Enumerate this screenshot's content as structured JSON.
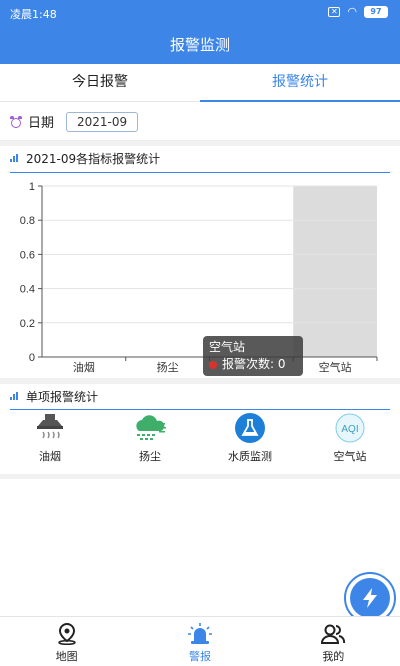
{
  "status_bar": {
    "time": "凌晨1:48",
    "battery": "97"
  },
  "header": {
    "title": "报警监测"
  },
  "tabs": [
    {
      "label": "今日报警",
      "active": false
    },
    {
      "label": "报警统计",
      "active": true
    }
  ],
  "date_filter": {
    "label": "日期",
    "value": "2021-09"
  },
  "chart_section": {
    "title": "2021-09各指标报警统计"
  },
  "chart_data": {
    "type": "bar",
    "categories": [
      "油烟",
      "扬尘",
      "水质监测",
      "空气站"
    ],
    "visible_category_labels": [
      "油烟",
      "扬尘",
      "",
      "空气站"
    ],
    "series": [
      {
        "name": "报警次数",
        "values": [
          0,
          0,
          0,
          0
        ]
      }
    ],
    "ylim": [
      0,
      1
    ],
    "yticks": [
      "0",
      "0.2",
      "0.4",
      "0.6",
      "0.8",
      "1"
    ],
    "highlighted_category": "空气站",
    "grid": true
  },
  "tooltip": {
    "title": "空气站",
    "series_label": "报警次数",
    "value": "0"
  },
  "single_section": {
    "title": "单项报警统计",
    "items": [
      {
        "label": "油烟",
        "icon": "range-hood-icon"
      },
      {
        "label": "扬尘",
        "icon": "dust-cloud-icon"
      },
      {
        "label": "水质监测",
        "icon": "water-quality-icon"
      },
      {
        "label": "空气站",
        "icon": "aqi-icon"
      }
    ]
  },
  "bottom_nav": [
    {
      "label": "地图",
      "icon": "map-pin-icon",
      "active": false
    },
    {
      "label": "警报",
      "icon": "alarm-light-icon",
      "active": true
    },
    {
      "label": "我的",
      "icon": "users-icon",
      "active": false
    }
  ],
  "colors": {
    "primary": "#3d86e8",
    "highlight": "#dcdcdc",
    "tooltip_dot": "#d9342b"
  }
}
